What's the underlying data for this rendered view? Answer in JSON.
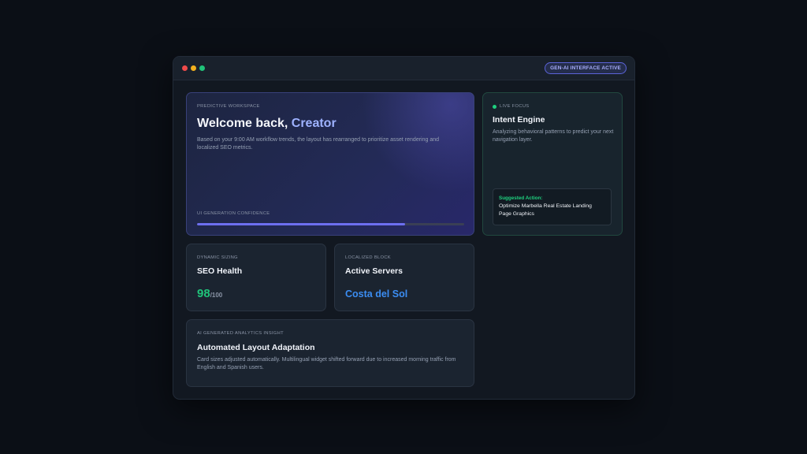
{
  "titlebar": {
    "status_badge": "GEN-AI INTERFACE ACTIVE"
  },
  "hero": {
    "label": "PREDICTIVE WORKSPACE",
    "greeting_prefix": "Welcome back,",
    "greeting_name": "Creator",
    "description": "Based on your 9:00 AM workflow trends, the layout has rearranged to prioritize asset rendering and localized SEO metrics.",
    "confidence_label": "UI GENERATION CONFIDENCE",
    "confidence": 0.78
  },
  "intent": {
    "label": "LIVE FOCUS",
    "title": "Intent Engine",
    "description": "Analyzing behavioral patterns to predict your next navigation layer.",
    "suggested_label": "Suggested Action:",
    "suggested_text": "Optimize Marbella Real Estate Landing Page Graphics"
  },
  "seo": {
    "label": "DYNAMIC SIZING",
    "title": "SEO Health",
    "score": "98",
    "score_max": "/100"
  },
  "servers": {
    "label": "LOCALIZED BLOCK",
    "title": "Active Servers",
    "region": "Costa del Sol"
  },
  "insight": {
    "label": "AI GENERATED ANALYTICS INSIGHT",
    "title": "Automated Layout Adaptation",
    "description": "Card sizes adjusted automatically. Multilingual widget shifted forward due to increased morning traffic from English and Spanish users."
  },
  "colors": {
    "background": "#0b0f16",
    "accent_indigo": "#6d6ff0",
    "accent_green": "#20c37a",
    "accent_blue": "#3b8df2"
  }
}
